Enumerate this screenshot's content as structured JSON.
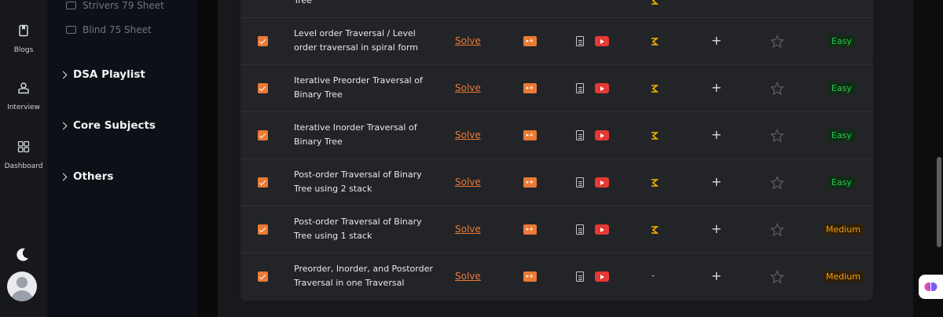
{
  "rail": {
    "items": [
      {
        "label": "Blogs",
        "icon": "bookmark-icon"
      },
      {
        "label": "Interview",
        "icon": "interview-icon"
      },
      {
        "label": "Dashboard",
        "icon": "dashboard-icon"
      }
    ],
    "theme_icon": "moon-icon",
    "avatar_icon": "user-avatar-icon"
  },
  "nav": {
    "sheets": [
      "Strivers 79 Sheet",
      "Blind 75 Sheet"
    ],
    "sections": [
      "DSA Playlist",
      "Core Subjects",
      "Others"
    ]
  },
  "table": {
    "solve_label": "Solve",
    "plus_label": "+",
    "rows": [
      {
        "title": "Tree",
        "difficulty": "",
        "checked": true
      },
      {
        "title": "Level order Traversal / Level order traversal in spiral form",
        "practice": "algo",
        "difficulty": "Easy",
        "checked": true
      },
      {
        "title": "Iterative Preorder Traversal of Binary Tree",
        "practice": "algo",
        "difficulty": "Easy",
        "checked": true
      },
      {
        "title": "Iterative Inorder Traversal of Binary Tree",
        "practice": "algo",
        "difficulty": "Easy",
        "checked": true
      },
      {
        "title": "Post-order Traversal of Binary Tree using 2 stack",
        "practice": "algo",
        "difficulty": "Easy",
        "checked": true
      },
      {
        "title": "Post-order Traversal of Binary Tree using 1 stack",
        "practice": "algo",
        "difficulty": "Medium",
        "checked": true
      },
      {
        "title": "Preorder, Inorder, and Postorder Traversal in one Traversal",
        "practice": "-",
        "difficulty": "Medium",
        "checked": true
      }
    ]
  },
  "colors": {
    "accent": "#ea7a35",
    "easy": "#28c94f",
    "medium": "#f39c12",
    "youtube": "#e53935",
    "algo_yellow": "#f5b700"
  }
}
